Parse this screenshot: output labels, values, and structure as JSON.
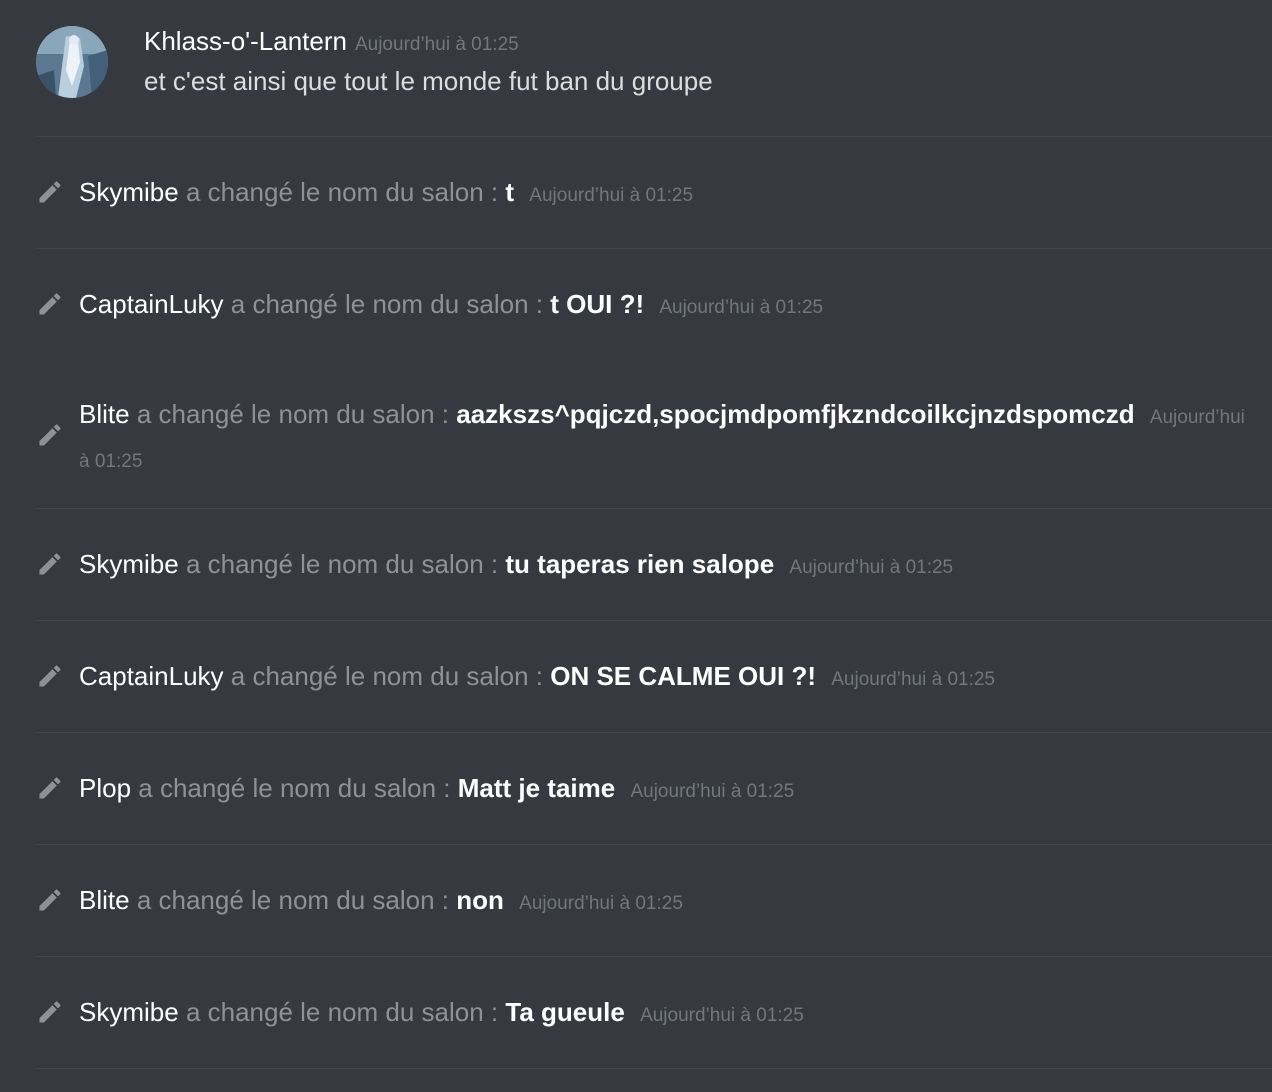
{
  "message": {
    "username": "Khlass-o'-Lantern",
    "timestamp": "Aujourd’hui à 01:25",
    "content": "et c'est ainsi que tout le monde fut ban du groupe"
  },
  "system_events": [
    {
      "user": "Skymibe",
      "action": "a changé le nom du salon :",
      "new_name": "t",
      "timestamp": "Aujourd’hui à 01:25"
    },
    {
      "user": "CaptainLuky",
      "action": "a changé le nom du salon :",
      "new_name": "t OUI ?!",
      "timestamp": "Aujourd’hui à 01:25"
    },
    {
      "user": "Blite",
      "action": "a changé le nom du salon :",
      "new_name": "aazkszs^pqjczd,spocjmdpomfjkzndcoilkcjnzdspomczd",
      "timestamp": "Aujourd’hui à 01:25"
    },
    {
      "user": "Skymibe",
      "action": "a changé le nom du salon :",
      "new_name": "tu taperas rien salope",
      "timestamp": "Aujourd’hui à 01:25"
    },
    {
      "user": "CaptainLuky",
      "action": "a changé le nom du salon :",
      "new_name": "ON SE CALME OUI ?!",
      "timestamp": "Aujourd’hui à 01:25"
    },
    {
      "user": "Plop",
      "action": "a changé le nom du salon :",
      "new_name": "Matt je taime",
      "timestamp": "Aujourd’hui à 01:25"
    },
    {
      "user": "Blite",
      "action": "a changé le nom du salon :",
      "new_name": "non",
      "timestamp": "Aujourd’hui à 01:25"
    },
    {
      "user": "Skymibe",
      "action": "a changé le nom du salon :",
      "new_name": "Ta gueule",
      "timestamp": "Aujourd’hui à 01:25"
    }
  ],
  "icons": {
    "system_event_icon": "pencil-icon"
  },
  "colors": {
    "background": "#36393f",
    "username": "#ffffff",
    "message_text": "#dcddde",
    "muted_text": "#8e9297",
    "timestamp": "#72767d",
    "divider": "#42454a"
  }
}
